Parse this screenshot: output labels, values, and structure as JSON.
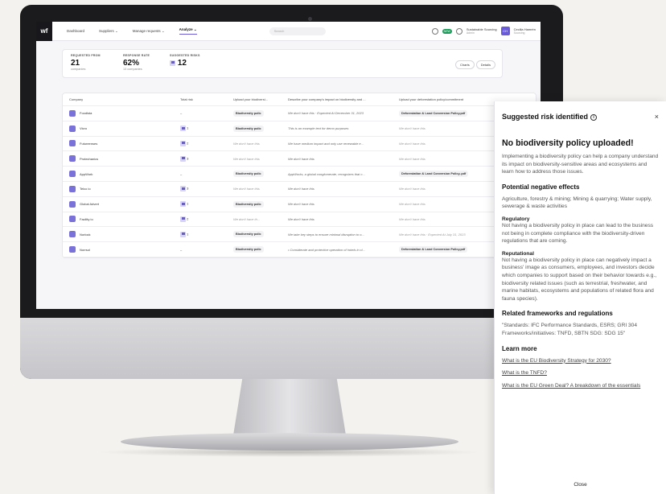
{
  "nav": {
    "logo": "wf",
    "items": [
      "Dashboard",
      "Suppliers ⌄",
      "Manage requests ⌄",
      "Analyze ⌄"
    ],
    "search_placeholder": "Search",
    "badge": "NEW",
    "org_name": "Sustainable Sourcing",
    "org_role": "Admin",
    "avatar": "CH",
    "user_name": "Cecilia Hamrén",
    "user_org": "Sourcing"
  },
  "stats": {
    "requested_label": "REQUESTED FROM",
    "requested_value": "21",
    "requested_sub": "companies",
    "response_label": "RESPONSE RATE",
    "response_value": "62%",
    "response_sub": "13 companies",
    "risks_label": "SUGGESTED RISKS",
    "risks_value": "12",
    "charts_label": "Charts",
    "details_label": "Details"
  },
  "table": {
    "headers": [
      "Company",
      "Total risk",
      "Upload your biodiversi...",
      "Describe your company's impact on biodiversity and ...",
      "Upload your deforestation policy/commitment"
    ],
    "rows": [
      {
        "company": "Foodista",
        "risk": "–",
        "policy": "Biodiversity polic",
        "impact": "We don't have this · Expected At December 31, 2023",
        "defor": "Deforestation & Land Conversion Policy.pdf"
      },
      {
        "company": "Vicro",
        "risk": "1",
        "policy": "Biodiversity polic",
        "impact": "This is an example text for demo purposes",
        "defor": "We don't have this"
      },
      {
        "company": "Futureenses",
        "risk": "2",
        "policy": "We don't have this",
        "impact": "We have medium impact and only use renewable e...",
        "defor": "We don't have this"
      },
      {
        "company": "Protechanics",
        "risk": "3",
        "policy": "We don't have this",
        "impact": "We don't have this",
        "defor": "We don't have this"
      },
      {
        "company": "AppWork",
        "risk": "–",
        "policy": "Biodiversity polic",
        "impact": "AppWorks, a global conglomerate, recognizes that c...",
        "defor": "Deforestation & Land Conversion Policy..pdf"
      },
      {
        "company": "Telco io",
        "risk": "3",
        "policy": "We don't have this",
        "impact": "We don't have this",
        "defor": "We don't have this"
      },
      {
        "company": "Global Advert",
        "risk": "1",
        "policy": "Biodiversity polic",
        "impact": "We don't have this",
        "defor": "We don't have this"
      },
      {
        "company": "Facility io",
        "risk": "2",
        "policy": "We don't have th...",
        "impact": "We don't have this",
        "defor": "We don't have this"
      },
      {
        "company": "Norlock",
        "risk": "1",
        "policy": "Biodiversity polic",
        "impact": "We take key steps to ensure minimal disruption to o...",
        "defor": "We don't have this · Expected At July 31, 2023"
      },
      {
        "company": "Norrsol",
        "risk": "–",
        "policy": "Biodiversity polic",
        "impact": "• Considerate and protective operation of hotels in cl...",
        "defor": "Deforestation & Land Conversion Policy.pdf"
      }
    ]
  },
  "drawer": {
    "title": "Suggested risk identified",
    "info_icon": "ⓘ",
    "close_icon": "×",
    "heading": "No biodiversity policy uploaded!",
    "intro": "Implementing a biodiversity policy can help a company understand its impact on biodiversity-sensitive areas and ecosystems and learn how to address those issues.",
    "effects_heading": "Potential negative effects",
    "effects_text": "Agriculture, forestry & mining; Mining & quarrying; Water supply, sewerage & waste activities",
    "regulatory_heading": "Regulatory",
    "regulatory_text": "Not having a biodiversity policy in place can lead to the business not being in complete compliance with the biodiversity-driven regulations that are coming.",
    "reputational_heading": "Reputational",
    "reputational_text": "Not having a biodiversity policy in place can negatively impact a business' image as consumers, employees, and investors decide which companies to support based on their behavior towards e.g., biodiversity related issues (such as terrestrial, freshwater, and marine habitats, ecosystems and populations of related flora and fauna species).",
    "frameworks_heading": "Related frameworks and regulations",
    "frameworks_text": "\"Standards: IFC Performance Standards, ESRS; GRI 304 Frameworks/initiatives: TNFD, SBTN SDG: SDG 15\"",
    "learn_heading": "Learn more",
    "link1": "What is the EU Biodiversity Strategy for 2030?",
    "link2": "What is the TNFD?",
    "link3": "What is the EU Green Deal? A breakdown of the essentials",
    "close_label": "Close"
  }
}
